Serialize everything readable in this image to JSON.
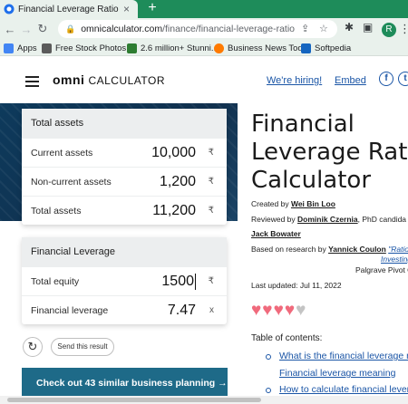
{
  "browser": {
    "tab_title": "Financial Leverage Ratio Calculat",
    "tab_close": "×",
    "new_tab": "+",
    "url_host": "omnicalculator.com",
    "url_path": "/finance/financial-leverage-ratio",
    "bookmarks": [
      {
        "label": "Apps",
        "color": "#4285f4"
      },
      {
        "label": "Free Stock Photos,...",
        "color": "#5b5b5b"
      },
      {
        "label": "2.6 million+ Stunni...",
        "color": "#2e7d32"
      },
      {
        "label": "Business News Tod...",
        "color": "#ff7a00"
      },
      {
        "label": "Softpedia",
        "color": "#1565c0"
      }
    ],
    "profile_initial": "R"
  },
  "header": {
    "logo": "omni",
    "logo_sub": "CALCULATOR",
    "hiring_link": "We're hiring!",
    "embed_link": "Embed",
    "social_facebook": "f",
    "social_twitter": "t"
  },
  "calculator": {
    "total_assets_panel": {
      "title": "Total assets",
      "rows": [
        {
          "label": "Current assets",
          "value": "10,000",
          "unit": "₹"
        },
        {
          "label": "Non-current assets",
          "value": "1,200",
          "unit": "₹"
        },
        {
          "label": "Total assets",
          "value": "11,200",
          "unit": "₹"
        }
      ]
    },
    "leverage_panel": {
      "title": "Financial Leverage",
      "rows": [
        {
          "label": "Total equity",
          "value": "1500",
          "unit": "₹"
        },
        {
          "label": "Financial leverage",
          "value": "7.47",
          "unit": "x"
        }
      ]
    },
    "send_result_label": "Send this result",
    "promo_label": "Check out 43 similar business planning →"
  },
  "article": {
    "title_lines": [
      "Financial",
      "Leverage Ratio",
      "Calculator"
    ],
    "created_by_prefix": "Created by ",
    "created_by": "Wei Bin Loo",
    "reviewed_by_prefix": "Reviewed by ",
    "reviewed_by": "Dominik Czernia",
    "reviewed_by_suffix": ", PhD candida",
    "reviewer2": "Jack Bowater",
    "research_prefix": "Based on research by ",
    "research_author": "Yannick Coulon",
    "research_title_1": "\"Ratio",
    "research_title_2": "Investing with Ratios\"",
    "research_publisher": "Palgrave Pivot Cham (",
    "last_updated": "Last updated: Jul 11, 2022",
    "rating_filled": 4,
    "rating_total": 5,
    "toc_title": "Table of contents:",
    "toc": [
      "What is the financial leverage ra",
      "Financial leverage meaning",
      "How to calculate financial lever"
    ]
  },
  "colors": {
    "heart_filled": "#f06a7c",
    "heart_empty": "#c4c4c4",
    "link": "#1a55a6",
    "promo": "#1e6a88",
    "tabbar": "#1e8c5a"
  }
}
